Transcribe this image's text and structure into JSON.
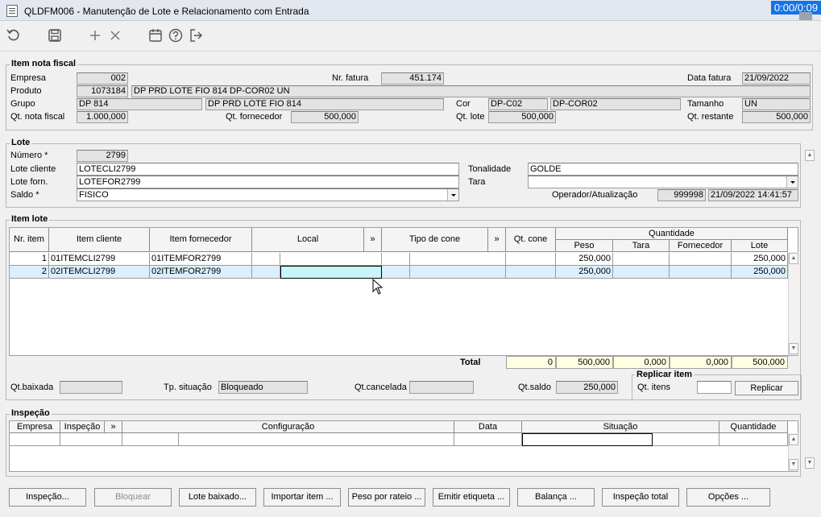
{
  "window": {
    "title": "QLDFM006 - Manutenção de Lote e Relacionamento com Entrada",
    "timer": "0:00/0:09"
  },
  "toolbar": {
    "icons": [
      "undo-icon",
      "save-icon",
      "add-icon",
      "delete-icon",
      "calendar-icon",
      "help-icon",
      "exit-icon"
    ]
  },
  "item_nota_fiscal": {
    "title": "Item nota fiscal",
    "empresa_label": "Empresa",
    "empresa": "002",
    "nr_fatura_label": "Nr. fatura",
    "nr_fatura": "451.174",
    "data_fatura_label": "Data fatura",
    "data_fatura": "21/09/2022",
    "produto_label": "Produto",
    "produto_code": "1073184",
    "produto_desc": "DP PRD LOTE FIO 814 DP-COR02 UN",
    "grupo_label": "Grupo",
    "grupo_code": "DP 814",
    "grupo_desc": "DP PRD LOTE FIO 814",
    "cor_label": "Cor",
    "cor_code": "DP-C02",
    "cor_desc": "DP-COR02",
    "tamanho_label": "Tamanho",
    "tamanho": "UN",
    "qt_nota_label": "Qt. nota fiscal",
    "qt_nota": "1.000,000",
    "qt_fornecedor_label": "Qt. fornecedor",
    "qt_fornecedor": "500,000",
    "qt_lote_label": "Qt. lote",
    "qt_lote": "500,000",
    "qt_restante_label": "Qt. restante",
    "qt_restante": "500,000"
  },
  "lote": {
    "title": "Lote",
    "numero_label": "Número *",
    "numero": "2799",
    "lote_cliente_label": "Lote cliente",
    "lote_cliente": "LOTECLI2799",
    "lote_forn_label": "Lote forn.",
    "lote_forn": "LOTEFOR2799",
    "saldo_label": "Saldo *",
    "saldo": "FISICO",
    "tonalidade_label": "Tonalidade",
    "tonalidade": "GOLDE",
    "tara_label": "Tara",
    "tara": "",
    "operador_label": "Operador/Atualização",
    "operador": "999998",
    "atualizacao": "21/09/2022 14:41:57"
  },
  "item_lote": {
    "title": "Item lote",
    "headers": {
      "nr_item": "Nr. item",
      "item_cliente": "Item cliente",
      "item_fornecedor": "Item fornecedor",
      "local": "Local",
      "expand1": "»",
      "tipo_cone": "Tipo de cone",
      "expand2": "»",
      "qt_cone": "Qt. cone",
      "quantidade": "Quantidade",
      "peso": "Peso",
      "tara": "Tara",
      "fornecedor": "Fornecedor",
      "lote": "Lote"
    },
    "rows": [
      {
        "nr": "1",
        "item_cliente": "01ITEMCLI2799",
        "item_fornecedor": "01ITEMFOR2799",
        "local": "",
        "tipo_cone": "",
        "qt_cone": "",
        "peso": "250,000",
        "tara": "",
        "fornecedor": "",
        "lote": "250,000"
      },
      {
        "nr": "2",
        "item_cliente": "02ITEMCLI2799",
        "item_fornecedor": "02ITEMFOR2799",
        "local": "",
        "tipo_cone": "",
        "qt_cone": "",
        "peso": "250,000",
        "tara": "",
        "fornecedor": "",
        "lote": "250,000"
      }
    ],
    "total_label": "Total",
    "totals": {
      "qt_cone": "0",
      "peso": "500,000",
      "tara": "0,000",
      "fornecedor": "0,000",
      "lote": "500,000"
    },
    "qt_baixada_label": "Qt.baixada",
    "qt_baixada": "",
    "tp_situacao_label": "Tp. situação",
    "tp_situacao": "Bloqueado",
    "qt_cancelada_label": "Qt.cancelada",
    "qt_cancelada": "",
    "qt_saldo_label": "Qt.saldo",
    "qt_saldo": "250,000",
    "replicar": {
      "title": "Replicar item",
      "qt_itens_label": "Qt. itens",
      "qt_itens": "",
      "button": "Replicar"
    }
  },
  "inspecao": {
    "title": "Inspeção",
    "headers": {
      "empresa": "Empresa",
      "inspecao": "Inspeção",
      "expand": "»",
      "configuracao": "Configuração",
      "data": "Data",
      "situacao": "Situação",
      "quantidade": "Quantidade"
    }
  },
  "buttons": {
    "inspecao": "Inspeção...",
    "bloquear": "Bloquear",
    "lote_baixado": "Lote baixado...",
    "importar_item": "Importar item ...",
    "peso_rateio": "Peso por rateio ...",
    "emitir_etiqueta": "Emitir etiqueta ...",
    "balanca": "Balança ...",
    "inspecao_total": "Inspeção total",
    "opcoes": "Opções ..."
  }
}
